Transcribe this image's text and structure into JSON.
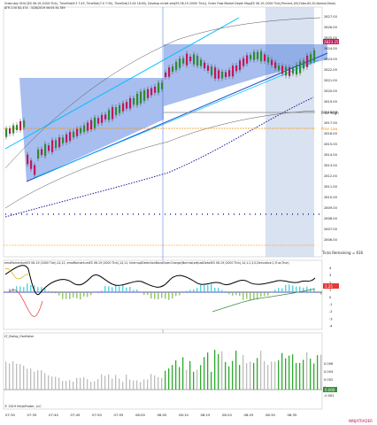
{
  "window": {
    "title_line1": "Order-day OHLC|ES 06-19 (2000 Tick), TimeSlot(9:3 7:45, TimeSlot(7:0 7:30), TimeSlot(13:45 16:00), Develop mrket site|ES 06-19 (2000 Tick)), Order Flow Market Depth Map|ES 06-19 (2000 Tick),Percent,100,False,60,20,Normal,False)",
    "title_line2": "ATR 2.50 B2.474 - 3/28/2019 06:05:34.789"
  },
  "price_panel": {
    "yaxis_labels": [
      "2827.00",
      "2826.00",
      "2825.00",
      "2824.00",
      "2823.00",
      "2822.00",
      "2821.00",
      "2820.00",
      "2819.00",
      "2818.00",
      "2817.00",
      "2816.00",
      "2815.00",
      "2814.00",
      "2813.00",
      "2812.00",
      "2811.00",
      "2810.00",
      "2809.00",
      "2808.00",
      "2807.00",
      "2806.00"
    ],
    "current_price_tag": "2823.25",
    "annotations": {
      "prior_high": "Prior High",
      "prior_low": "Prior Low",
      "ticks_remaining": "Ticks Remaining = 616"
    },
    "colors": {
      "up_candle": "#2e8b2e",
      "down_candle": "#c0185a",
      "channel_fill": "#3b6fdc",
      "session_shade": "#c9d6ea",
      "trend_line": "#00bfff",
      "prior_high_line": "#7f7f7f",
      "prior_low_line": "#ff8c00",
      "dotted_line": "#1a1aa0"
    }
  },
  "momentum_panel": {
    "title": "emaMomentumES 06-19 (2000 Tick),14,12, emaMomentumES 06-19 (2000 Tick),14,11, InterruptDetectionBandOpenChange(Normal(setJustDetailES 06-19 (2000 Tick),14,1.2,3,0,Derivative,1,True,True)",
    "yaxis_labels": [
      "4",
      "3",
      "2",
      "1",
      "0",
      "-1",
      "-2",
      "-3",
      "-4"
    ],
    "current_value_tag": "1.25"
  },
  "oscillator_panel": {
    "title": "LT_Swing_Oscillator",
    "yaxis_labels": [
      "0.006",
      "0.004",
      "0.002",
      "0",
      "-0.002"
    ],
    "copyright": "© 2019 NinjaTrader, LLC",
    "current_value_tag": "0.000"
  },
  "xaxis_labels": [
    "07:30",
    "07:35",
    "07:40",
    "07:45",
    "07:50",
    "07:55",
    "08:00",
    "08:05",
    "08:10",
    "08:15",
    "08:20",
    "08:25",
    "08:30",
    "08:35"
  ],
  "watermark": "NINJATRADER"
}
